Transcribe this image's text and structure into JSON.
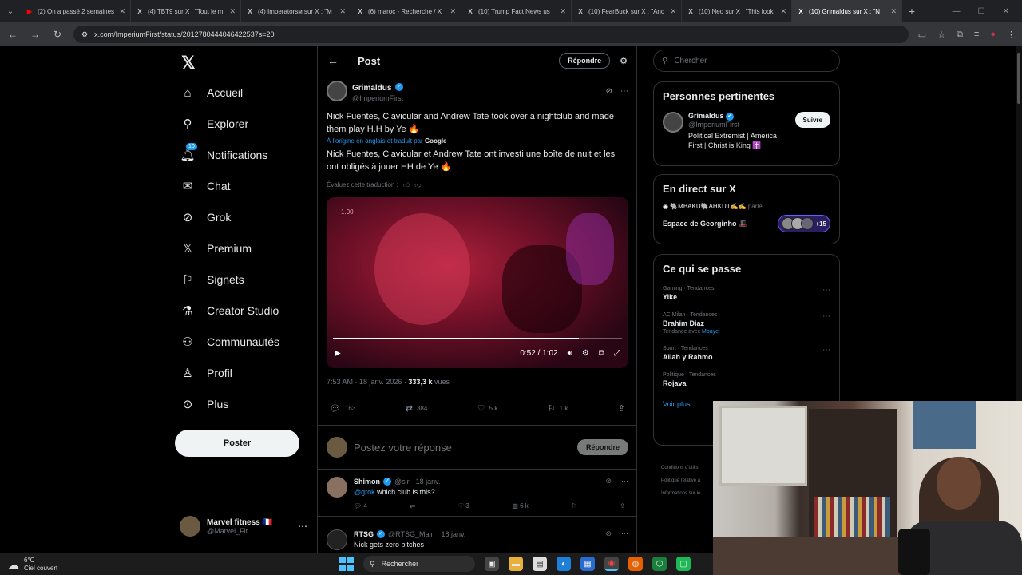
{
  "browser": {
    "tabs": [
      {
        "label": "(2) On a passé 2 semaines",
        "icon": "youtube-icon",
        "color": "#ff0000"
      },
      {
        "label": "(4) TBT9 sur X : \"Tout le m",
        "icon": "x-icon",
        "color": "#ffffff"
      },
      {
        "label": "(4) Imperatorsм sur X : \"M",
        "icon": "x-icon",
        "color": "#ffffff"
      },
      {
        "label": "(6) maroc - Recherche / X",
        "icon": "x-icon",
        "color": "#ffffff"
      },
      {
        "label": "(10) Trump Fact News us",
        "icon": "x-icon",
        "color": "#ffffff"
      },
      {
        "label": "(10) FearBuck sur X : \"Anc",
        "icon": "x-icon",
        "color": "#ffffff"
      },
      {
        "label": "(10) Neo sur X : \"This look",
        "icon": "x-icon",
        "color": "#ffffff"
      },
      {
        "label": "(10) Grimaldus sur X : \"N",
        "icon": "x-icon",
        "color": "#ffffff",
        "active": true
      }
    ],
    "url": "x.com/ImperiumFirst/status/2012780444046422537s=20"
  },
  "nav": {
    "items": [
      {
        "label": "Accueil",
        "icon": "home-icon"
      },
      {
        "label": "Explorer",
        "icon": "search-icon"
      },
      {
        "label": "Notifications",
        "icon": "bell-icon",
        "badge": "10"
      },
      {
        "label": "Chat",
        "icon": "mail-icon"
      },
      {
        "label": "Grok",
        "icon": "grok-icon"
      },
      {
        "label": "Premium",
        "icon": "x-icon"
      },
      {
        "label": "Signets",
        "icon": "bookmark-icon"
      },
      {
        "label": "Creator Studio",
        "icon": "flask-icon"
      },
      {
        "label": "Communautés",
        "icon": "people-icon"
      },
      {
        "label": "Profil",
        "icon": "person-icon"
      },
      {
        "label": "Plus",
        "icon": "more-circle-icon"
      }
    ],
    "post_button": "Poster",
    "account": {
      "name": "Marvel fitness 🇫🇷",
      "handle": "@Marvel_Fit"
    }
  },
  "post": {
    "header_title": "Post",
    "reply_chip": "Répondre",
    "author_name": "Grimaldus",
    "author_handle": "@ImperiumFirst",
    "text_original": "Nick Fuentes, Clavicular and Andrew Tate took over a nightclub and made them play H.H by Ye 🔥",
    "translated_prefix": "À l'origine en anglais et traduit par",
    "translated_by": "Google",
    "text_translated": "Nick Fuentes, Clavicular et Andrew Tate ont investi une boîte de nuit et les ont obligés à jouer HH de Ye 🔥",
    "rate_translation": "Évaluez cette traduction :",
    "video": {
      "rate": "1.00",
      "time": "0:52 / 1:02",
      "progress_fraction": 0.85
    },
    "time": "7:53 AM · 18 janv. 2026 ·",
    "views": "333,3 k",
    "views_label": "vues",
    "stats": {
      "replies": "163",
      "reposts": "384",
      "likes": "5 k",
      "bookmarks": "1 k"
    }
  },
  "composer": {
    "placeholder": "Postez votre réponse",
    "button": "Répondre"
  },
  "replies": [
    {
      "name": "Shimon",
      "handle": "@slr · 18 janv.",
      "mention": "@grok",
      "text": " which club is this?",
      "replies": "4",
      "reposts": "",
      "likes": "3",
      "views": "6 k"
    },
    {
      "name": "RTSG",
      "handle": "@RTSG_Main · 18 janv.",
      "mention": "",
      "text": "Nick gets zero bitches"
    }
  ],
  "right": {
    "search_placeholder": "Chercher",
    "people_title": "Personnes pertinentes",
    "person": {
      "name": "Grimaldus",
      "handle": "@ImperiumFirst",
      "bio": "Political Extremist | America First | Christ is King ✝️",
      "follow": "Suivre"
    },
    "live_title": "En direct sur X",
    "live_host": "🐘MBAKU🐘AHKUT✍️✍️",
    "live_host_suffix": "parle.",
    "live_space": "Espace de Georginho 🎩",
    "live_count": "+15",
    "trends_title": "Ce qui se passe",
    "trends": [
      {
        "context": "Gaming · Tendances",
        "name": "Yike",
        "with": ""
      },
      {
        "context": "AC Milan · Tendances",
        "name": "Brahim Diaz",
        "with": "Mbaye",
        "with_prefix": "Tendance avec"
      },
      {
        "context": "Sport · Tendances",
        "name": "Allah y Rahmo",
        "with": ""
      },
      {
        "context": "Politique · Tendances",
        "name": "Rojava",
        "with": ""
      }
    ],
    "see_more": "Voir plus",
    "footer": [
      "Conditions d'utilis",
      "Politique relative a",
      "Informations sur le"
    ]
  },
  "taskbar": {
    "temp": "6°C",
    "weather": "Ciel couvert",
    "search": "Rechercher"
  }
}
